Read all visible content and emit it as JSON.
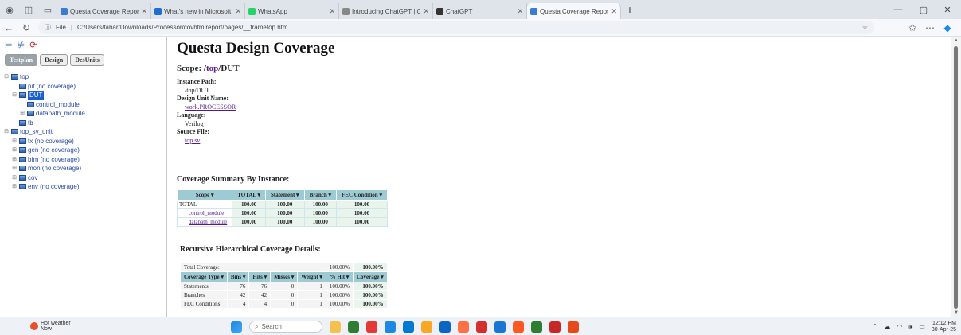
{
  "browser": {
    "tabs": [
      {
        "title": "Questa Coverage Report",
        "color": "#3a7bd5"
      },
      {
        "title": "What's new in Microsoft",
        "color": "#1f6fd0"
      },
      {
        "title": "WhatsApp",
        "color": "#25d366"
      },
      {
        "title": "Introducing ChatGPT | Op",
        "color": "#888888"
      },
      {
        "title": "ChatGPT",
        "color": "#333333"
      },
      {
        "title": "Questa Coverage Report",
        "color": "#3a7bd5"
      }
    ],
    "new_tab": "+",
    "address": {
      "label": "File",
      "url": "C:/Users/fahar/Downloads/Processor/covhtmlreport/pages/__frametop.htm"
    }
  },
  "left_frame": {
    "tabs": [
      "Testplan",
      "Design",
      "DesUnits"
    ],
    "tree": [
      {
        "label": "top",
        "depth": 0,
        "toggle": "⊟"
      },
      {
        "label": "pif (no coverage)",
        "depth": 1,
        "toggle": ""
      },
      {
        "label": "DUT",
        "depth": 1,
        "toggle": "⊟",
        "selected": true
      },
      {
        "label": "control_module",
        "depth": 2,
        "toggle": ""
      },
      {
        "label": "datapath_module",
        "depth": 2,
        "toggle": "⊞"
      },
      {
        "label": "tb",
        "depth": 1,
        "toggle": ""
      },
      {
        "label": "top_sv_unit",
        "depth": 0,
        "toggle": "⊟"
      },
      {
        "label": "tx (no coverage)",
        "depth": 1,
        "toggle": "⊞"
      },
      {
        "label": "gen (no coverage)",
        "depth": 1,
        "toggle": "⊞"
      },
      {
        "label": "bfm (no coverage)",
        "depth": 1,
        "toggle": "⊞"
      },
      {
        "label": "mon (no coverage)",
        "depth": 1,
        "toggle": "⊞"
      },
      {
        "label": "cov",
        "depth": 1,
        "toggle": "⊞"
      },
      {
        "label": "env (no coverage)",
        "depth": 1,
        "toggle": "⊞"
      }
    ]
  },
  "main": {
    "title": "Questa Design Coverage",
    "scope_label": "Scope: /",
    "scope_top": "top",
    "scope_rest": "/DUT",
    "instance_path_label": "Instance Path:",
    "instance_path": "/top/DUT",
    "design_unit_label": "Design Unit Name:",
    "design_unit": "work.PROCESSOR",
    "language_label": "Language:",
    "language": "Verilog",
    "source_label": "Source File:",
    "source": "top.sv",
    "summary_heading": "Coverage Summary By Instance:",
    "summary_headers": [
      "Scope ▾",
      "TOTAL ▾",
      "Statement ▾",
      "Branch ▾",
      "FEC Condition ▾"
    ],
    "summary_rows": [
      {
        "scope": "TOTAL",
        "link": false,
        "values": [
          "100.00",
          "100.00",
          "100.00",
          "100.00"
        ]
      },
      {
        "scope": "control_module",
        "link": true,
        "values": [
          "100.00",
          "100.00",
          "100.00",
          "100.00"
        ]
      },
      {
        "scope": "datapath_module",
        "link": true,
        "values": [
          "100.00",
          "100.00",
          "100.00",
          "100.00"
        ]
      }
    ],
    "details_heading": "Recursive Hierarchical Coverage Details:",
    "total_label": "Total Coverage:",
    "total_pct": "100.00%",
    "total_cov": "100.00%",
    "details_headers": [
      "Coverage Type ▾",
      "Bins ▾",
      "Hits ▾",
      "Misses ▾",
      "Weight ▾",
      "% Hit ▾",
      "Coverage ▾"
    ],
    "details_rows": [
      [
        "Statements",
        "76",
        "76",
        "0",
        "1",
        "100.00%",
        "100.00%"
      ],
      [
        "Branches",
        "42",
        "42",
        "0",
        "1",
        "100.00%",
        "100.00%"
      ],
      [
        "FEC Conditions",
        "4",
        "4",
        "0",
        "1",
        "100.00%",
        "100.00%"
      ]
    ]
  },
  "taskbar": {
    "weather_line1": "Hot weather",
    "weather_line2": "Now",
    "search": "Search",
    "apps": [
      "#f2c14e",
      "#2e7d32",
      "#e53935",
      "#1e88e5",
      "#0078d4",
      "#f9a825",
      "#0a66c2",
      "#ff7043",
      "#d32f2f",
      "#1976d2",
      "#ff5722",
      "#2e7d32",
      "#c62828",
      "#e64a19"
    ],
    "time": "12:12 PM",
    "date": "30-Apr-25"
  }
}
